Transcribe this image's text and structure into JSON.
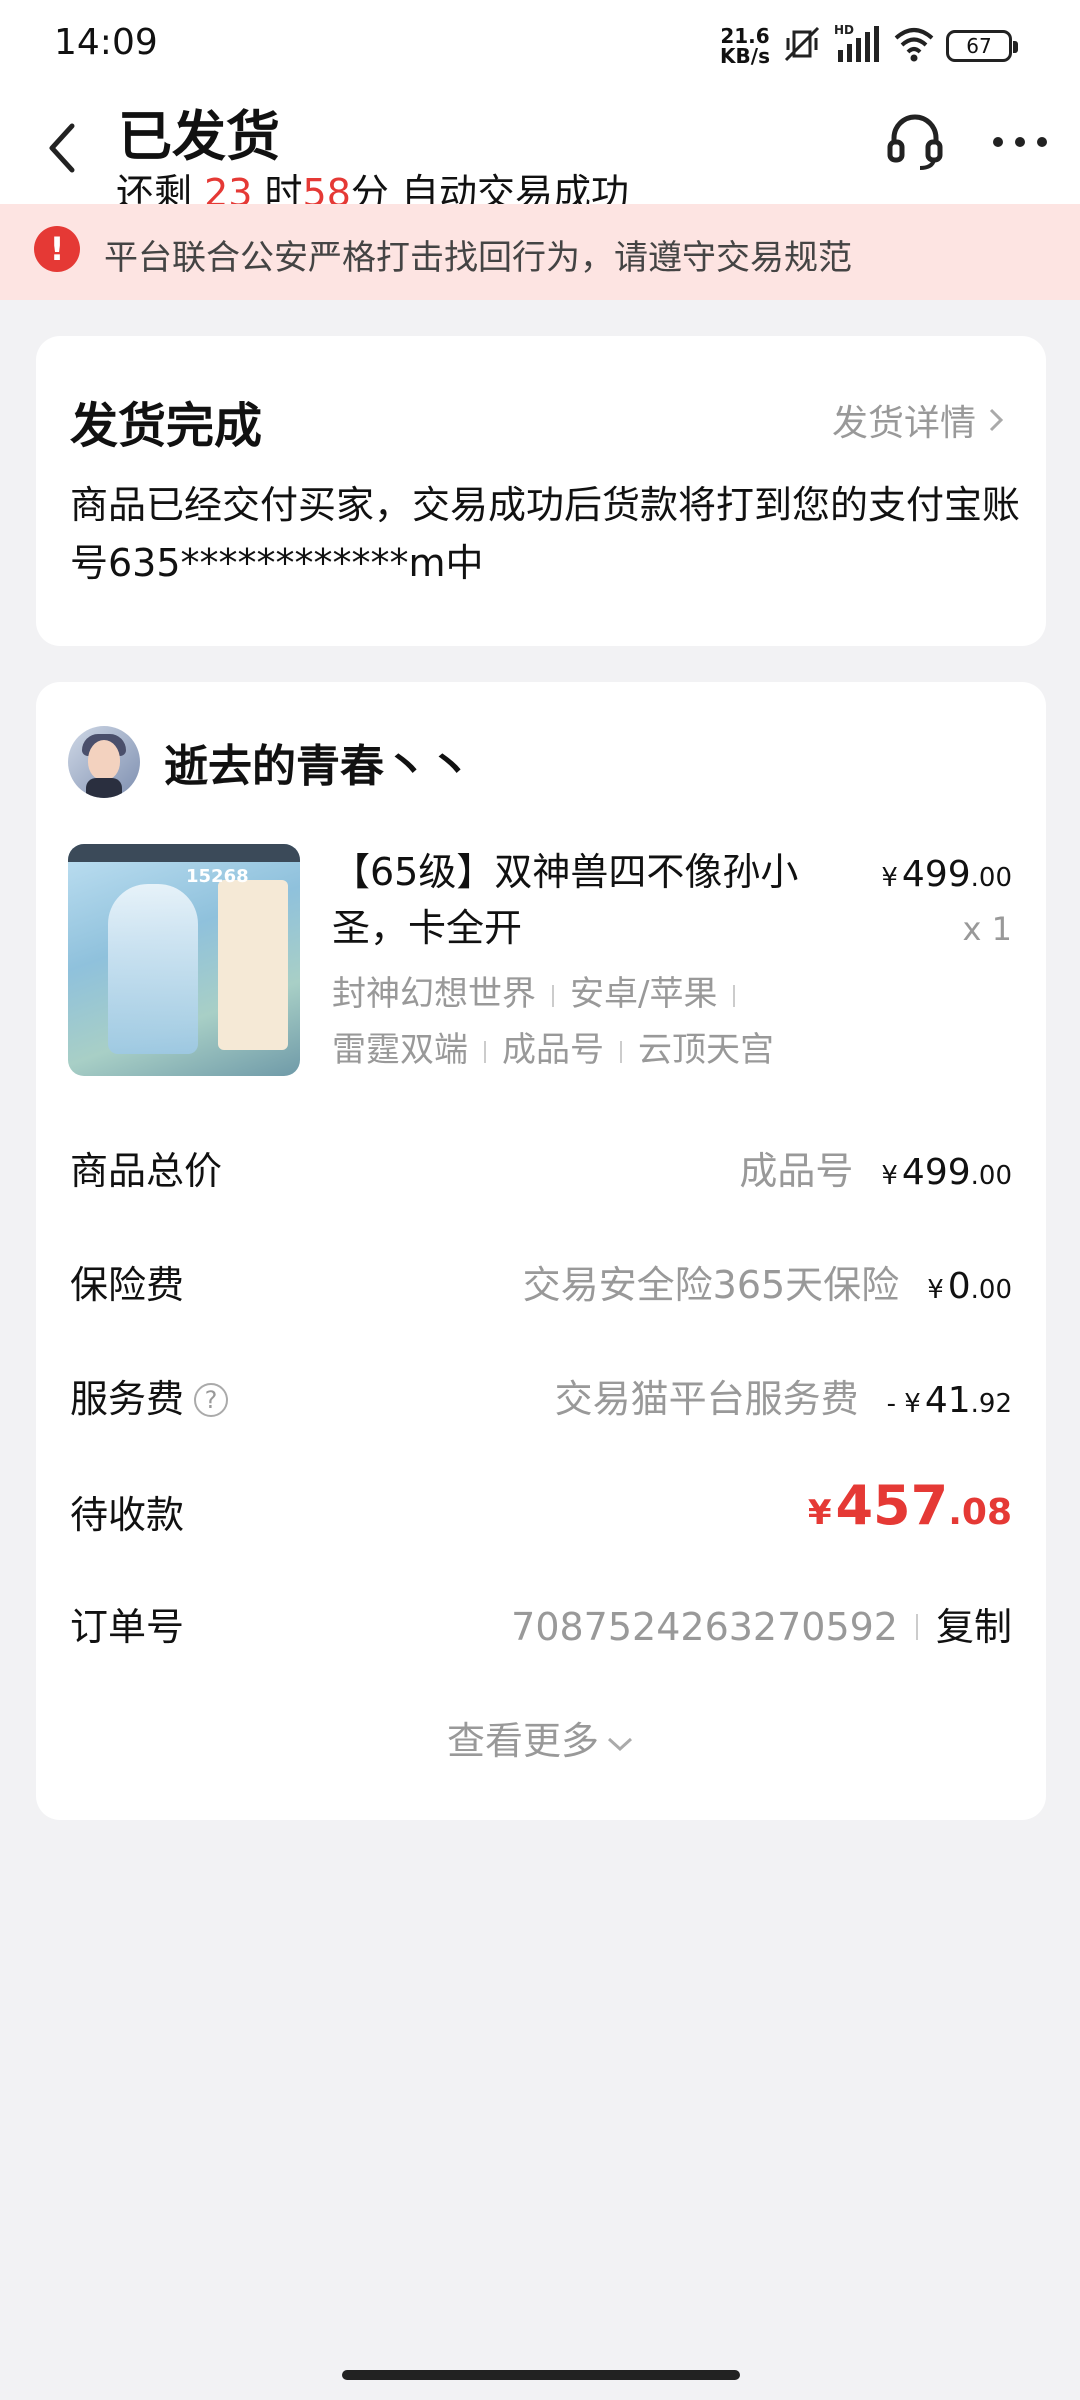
{
  "status_bar": {
    "time": "14:09",
    "net_speed_value": "21.6",
    "net_speed_unit": "KB/s",
    "battery": "67"
  },
  "header": {
    "title": "已发货",
    "sub_prefix": "还剩 ",
    "hours": "23",
    "hours_unit": " 时",
    "minutes": "58",
    "sub_suffix": "分 自动交易成功",
    "icons": [
      "back-icon",
      "headset-icon",
      "more-icon"
    ]
  },
  "alert": {
    "icon": "!",
    "text": "平台联合公安严格打击找回行为，请遵守交易规范"
  },
  "delivery": {
    "title": "发货完成",
    "link_label": "发货详情",
    "description": "商品已经交付买家，交易成功后货款将打到您的支付宝账号635************m中"
  },
  "order": {
    "seller_name": "逝去的青春丶丶",
    "product": {
      "thumb_badge": "15268",
      "title": "【65级】双神兽四不像孙小圣，卡全开",
      "price_yen": "¥",
      "price_int": "499",
      "price_dec": ".00",
      "qty": "x 1",
      "tags_line1": [
        "封神幻想世界",
        "安卓/苹果",
        ""
      ],
      "tags_line2": [
        "雷霆双端",
        "成品号",
        "云顶天宫"
      ]
    },
    "rows": {
      "total": {
        "label": "商品总价",
        "note": "成品号",
        "yen": "¥",
        "int": "499",
        "dec": ".00"
      },
      "insurance": {
        "label": "保险费",
        "note": "交易安全险365天保险",
        "yen": "¥",
        "int": "0",
        "dec": ".00"
      },
      "service": {
        "label": "服务费",
        "help": "?",
        "note": "交易猫平台服务费",
        "yen": "- ¥",
        "int": "41",
        "dec": ".92"
      },
      "pending": {
        "label": "待收款",
        "yen": "¥",
        "int": "457",
        "dec": ".08"
      },
      "order_no": {
        "label": "订单号",
        "value": "7087524263270592",
        "copy": "复制"
      }
    },
    "view_more": "查看更多"
  },
  "colors": {
    "accent_red": "#e53935",
    "alert_bg": "#fde4e2",
    "page_bg": "#f2f2f4"
  }
}
